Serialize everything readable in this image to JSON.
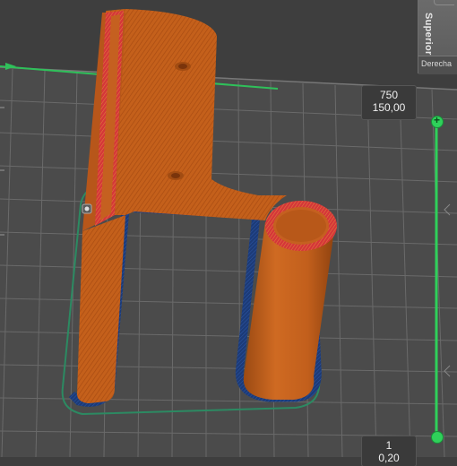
{
  "nav_cube": {
    "top_face_label": "Superior",
    "right_face_label": "Derecha"
  },
  "layer_slider": {
    "top_layer": "750",
    "top_height": "150,00",
    "bottom_layer": "1",
    "bottom_height": "0,20"
  },
  "colors": {
    "background": "#3e3e3e",
    "bed_grid": "#6a6a6a",
    "perimeter_orange": "#c8621c",
    "outer_wall_red": "#d8343a",
    "first_layer_blue": "#1d3d7a",
    "skirt_green": "#2c8a62",
    "slider_green": "#2fd05a"
  }
}
